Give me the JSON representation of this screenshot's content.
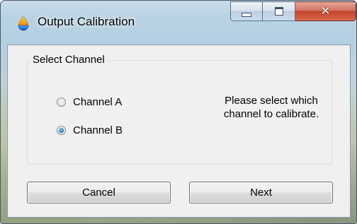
{
  "window": {
    "title": "Output Calibration",
    "icon": "droplet-app-icon",
    "caption_buttons": {
      "minimize": "minimize-icon",
      "maximize": "maximize-icon",
      "close": "close-icon",
      "close_color": "#c4442c"
    }
  },
  "group": {
    "title": "Select Channel",
    "options": [
      {
        "label": "Channel A",
        "checked": false
      },
      {
        "label": "Channel B",
        "checked": true
      }
    ],
    "hint": "Please select which channel to calibrate."
  },
  "buttons": {
    "cancel": "Cancel",
    "next": "Next"
  }
}
